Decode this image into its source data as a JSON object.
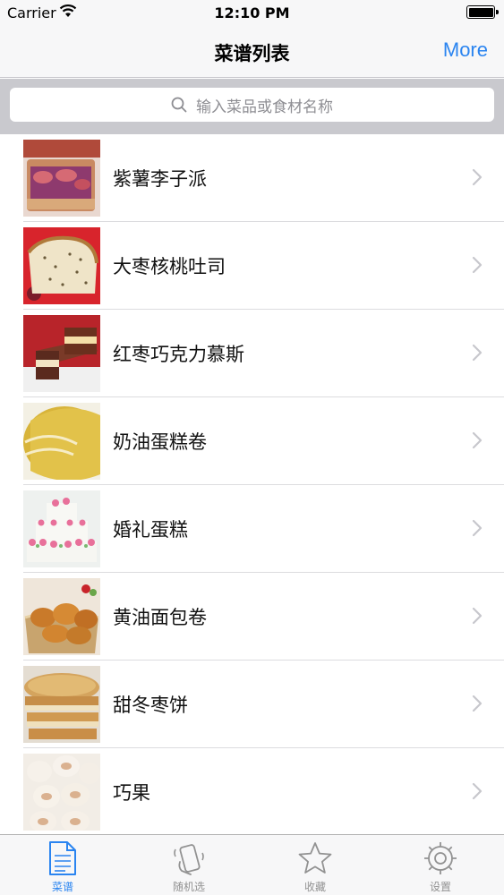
{
  "status": {
    "carrier": "Carrier",
    "time": "12:10 PM"
  },
  "nav": {
    "title": "菜谱列表",
    "more_label": "More"
  },
  "search": {
    "placeholder": "输入菜品或食材名称"
  },
  "recipes": [
    {
      "name": "紫薯李子派",
      "image": "purple-sweet-potato-plum-pie-photo"
    },
    {
      "name": "大枣核桃吐司",
      "image": "jujube-walnut-toast-photo"
    },
    {
      "name": "红枣巧克力慕斯",
      "image": "red-date-chocolate-mousse-photo"
    },
    {
      "name": "奶油蛋糕卷",
      "image": "cream-cake-roll-photo"
    },
    {
      "name": "婚礼蛋糕",
      "image": "wedding-cake-photo"
    },
    {
      "name": "黄油面包卷",
      "image": "butter-bread-roll-photo"
    },
    {
      "name": "甜冬枣饼",
      "image": "sweet-winter-date-cake-photo"
    },
    {
      "name": "巧果",
      "image": "qiaoguo-pastry-photo"
    }
  ],
  "tabs": [
    {
      "label": "菜谱",
      "icon": "document-icon",
      "active": true
    },
    {
      "label": "随机选",
      "icon": "shake-phone-icon",
      "active": false
    },
    {
      "label": "收藏",
      "icon": "star-icon",
      "active": false
    },
    {
      "label": "设置",
      "icon": "gear-icon",
      "active": false
    }
  ],
  "colors": {
    "accent": "#2a84f0",
    "tab_inactive": "#929292",
    "search_bg": "#c9c9ce"
  }
}
